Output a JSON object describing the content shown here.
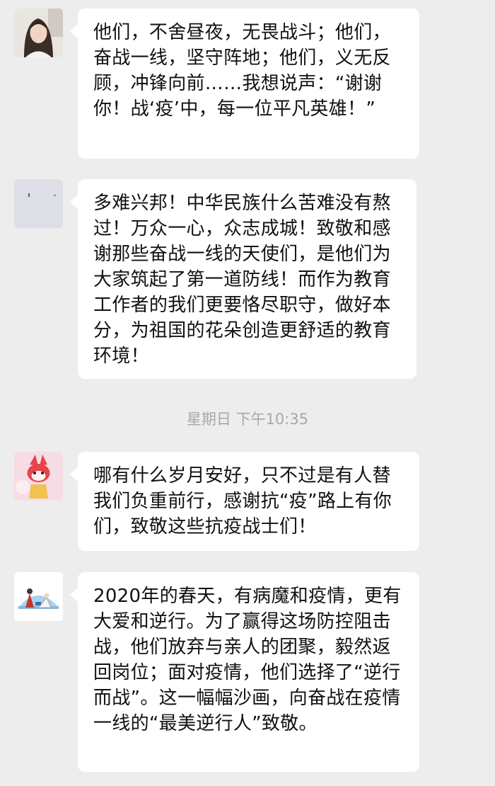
{
  "messages": [
    {
      "avatar": "woman-photo-avatar",
      "text": "他们，不舍昼夜，无畏战斗；他们，奋战一线，坚守阵地；他们，义无反顾，冲锋向前……我想说声：“谢谢你！战‘疫’中，每一位平凡英雄！”"
    },
    {
      "avatar": "blank-gray-avatar",
      "text": "多难兴邦！中华民族什么苦难没有熬过！万众一心，众志成城！致敬和感谢那些奋战一线的天使们，是他们为大家筑起了第一道防线！而作为教育工作者的我们更要恪尽职守，做好本分，为祖国的花朵创造更舒适的教育环境！"
    },
    {
      "avatar": "cartoon-fox-avatar",
      "text": "哪有什么岁月安好，只不过是有人替我们负重前行，感谢抗“疫”路上有你们，致敬这些抗疫战士们！"
    },
    {
      "avatar": "illustration-avatar",
      "text": "2020年的春天，有病魔和疫情，更有大爱和逆行。为了赢得这场防控阻击战，他们放弃与亲人的团聚，毅然返回岗位；面对疫情，他们选择了“逆行而战”。这一幅幅沙画，向奋战在疫情一线的“最美逆行人”致敬。"
    }
  ],
  "timestamp": "星期日 下午10:35"
}
